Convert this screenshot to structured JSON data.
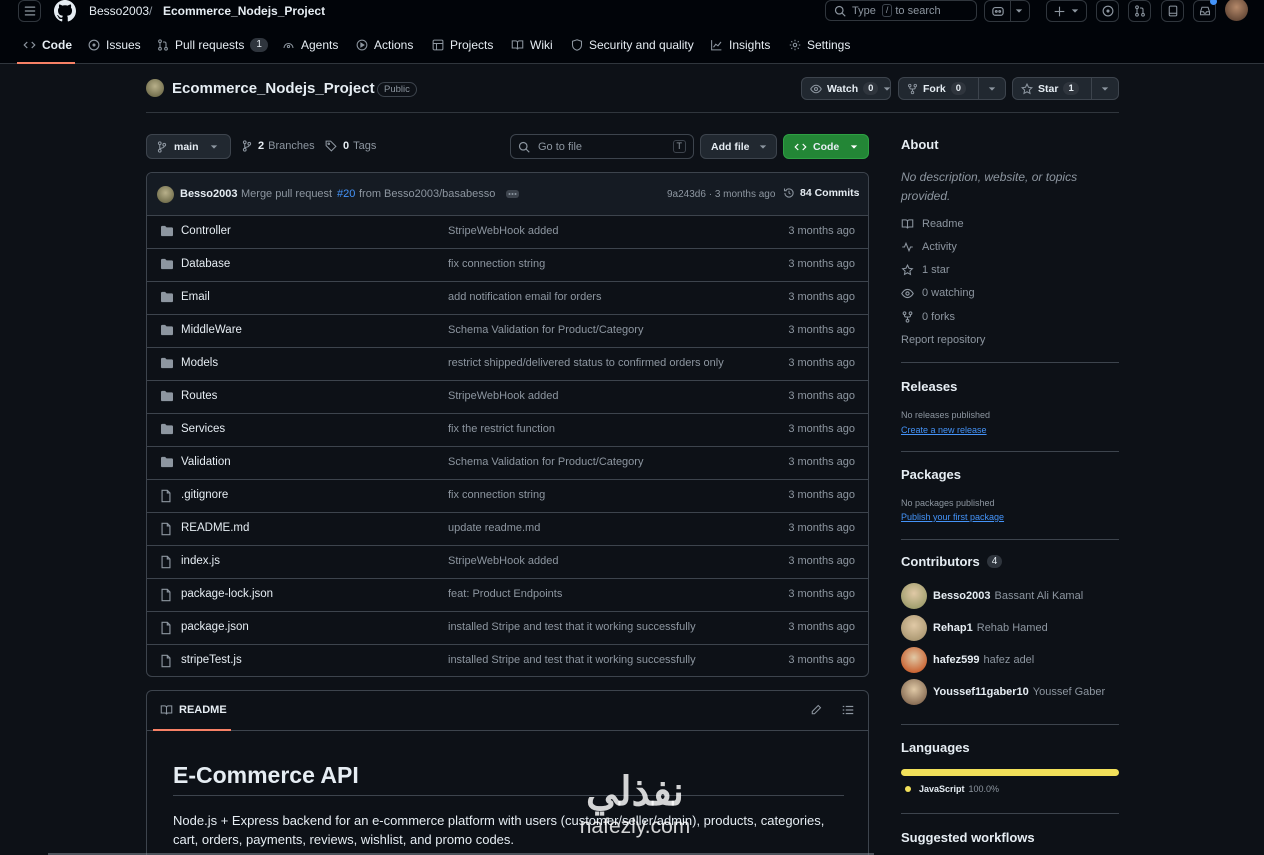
{
  "header": {
    "owner": "Besso2003",
    "separator": "/",
    "repo": "Ecommerce_Nodejs_Project",
    "search_placeholder_pre": "Type",
    "search_key": "/",
    "search_placeholder_post": "to search"
  },
  "nav": {
    "tabs": [
      {
        "label": "Code",
        "icon": "code-icon",
        "active": true
      },
      {
        "label": "Issues",
        "icon": "issue-icon"
      },
      {
        "label": "Pull requests",
        "icon": "pull-request-icon",
        "count": "1"
      },
      {
        "label": "Agents",
        "icon": "agents-icon"
      },
      {
        "label": "Actions",
        "icon": "play-icon"
      },
      {
        "label": "Projects",
        "icon": "table-icon"
      },
      {
        "label": "Wiki",
        "icon": "book-icon"
      },
      {
        "label": "Security and quality",
        "icon": "shield-icon"
      },
      {
        "label": "Insights",
        "icon": "graph-icon"
      },
      {
        "label": "Settings",
        "icon": "gear-icon"
      }
    ]
  },
  "repo": {
    "name": "Ecommerce_Nodejs_Project",
    "visibility": "Public",
    "watch_label": "Watch",
    "watch_count": "0",
    "fork_label": "Fork",
    "fork_count": "0",
    "star_label": "Star",
    "star_count": "1"
  },
  "toolbar": {
    "branch": "main",
    "branches_count": "2",
    "branches_label": "Branches",
    "tags_count": "0",
    "tags_label": "Tags",
    "goto_placeholder": "Go to file",
    "goto_key": "T",
    "add_file": "Add file",
    "code": "Code"
  },
  "commit": {
    "author": "Besso2003",
    "message_pre": "Merge pull request",
    "pr_link": "#20",
    "message_post": "from Besso2003/basabesso",
    "hash_time": "9a243d6 · 3 months ago",
    "commits_count": "84 Commits"
  },
  "files": [
    {
      "type": "dir",
      "name": "Controller",
      "message": "StripeWebHook added",
      "date": "3 months ago"
    },
    {
      "type": "dir",
      "name": "Database",
      "message": "fix connection string",
      "date": "3 months ago"
    },
    {
      "type": "dir",
      "name": "Email",
      "message": "add notification email for orders",
      "date": "3 months ago"
    },
    {
      "type": "dir",
      "name": "MiddleWare",
      "message": "Schema Validation for Product/Category",
      "date": "3 months ago"
    },
    {
      "type": "dir",
      "name": "Models",
      "message": "restrict shipped/delivered status to confirmed orders only",
      "date": "3 months ago"
    },
    {
      "type": "dir",
      "name": "Routes",
      "message": "StripeWebHook added",
      "date": "3 months ago"
    },
    {
      "type": "dir",
      "name": "Services",
      "message": "fix the restrict function",
      "date": "3 months ago"
    },
    {
      "type": "dir",
      "name": "Validation",
      "message": "Schema Validation for Product/Category",
      "date": "3 months ago"
    },
    {
      "type": "file",
      "name": ".gitignore",
      "message": "fix connection string",
      "date": "3 months ago"
    },
    {
      "type": "file",
      "name": "README.md",
      "message": "update readme.md",
      "date": "3 months ago"
    },
    {
      "type": "file",
      "name": "index.js",
      "message": "StripeWebHook added",
      "date": "3 months ago"
    },
    {
      "type": "file",
      "name": "package-lock.json",
      "message": "feat: Product Endpoints",
      "date": "3 months ago"
    },
    {
      "type": "file",
      "name": "package.json",
      "message": "installed Stripe and test that it working successfully",
      "date": "3 months ago"
    },
    {
      "type": "file",
      "name": "stripeTest.js",
      "message": "installed Stripe and test that it working successfully",
      "date": "3 months ago"
    }
  ],
  "readme": {
    "tab_label": "README",
    "title": "E-Commerce API",
    "description": "Node.js + Express backend for an e-commerce platform with users (customer/seller/admin), products, categories, cart, orders, payments, reviews, wishlist, and promo codes."
  },
  "about": {
    "title": "About",
    "description": "No description, website, or topics provided.",
    "items": [
      {
        "icon": "book-icon",
        "label": "Readme"
      },
      {
        "icon": "pulse-icon",
        "label": "Activity"
      },
      {
        "icon": "star-icon",
        "label": "1 star"
      },
      {
        "icon": "eye-icon",
        "label": "0 watching"
      },
      {
        "icon": "fork-icon",
        "label": "0 forks"
      }
    ],
    "report": "Report repository"
  },
  "releases": {
    "title": "Releases",
    "empty": "No releases published",
    "link": "Create a new release"
  },
  "packages": {
    "title": "Packages",
    "empty": "No packages published",
    "link": "Publish your first package"
  },
  "contributors": {
    "title": "Contributors",
    "count": "4",
    "people": [
      {
        "login": "Besso2003",
        "name": "Bassant Ali Kamal",
        "color": "#8a8f5a"
      },
      {
        "login": "Rehap1",
        "name": "Rehab Hamed",
        "color": "#9c8a63"
      },
      {
        "login": "hafez599",
        "name": "hafez adel",
        "color": "#c2410c"
      },
      {
        "login": "Youssef11gaber10",
        "name": "Youssef Gaber",
        "color": "#6b4f3a"
      }
    ]
  },
  "languages": {
    "title": "Languages",
    "items": [
      {
        "name": "JavaScript",
        "percent": "100.0%",
        "color": "#f1e05a"
      }
    ]
  },
  "suggested": {
    "title": "Suggested workflows"
  },
  "watermark": {
    "arabic": "نفذلي",
    "latin": "nafezly.com"
  }
}
